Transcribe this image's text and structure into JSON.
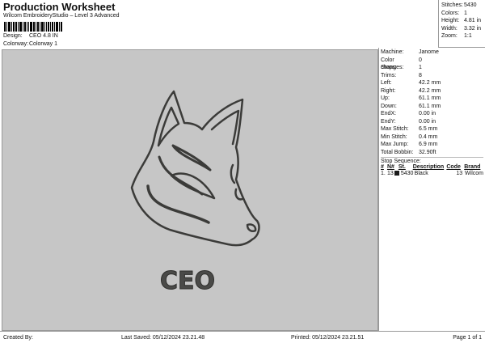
{
  "header": {
    "title": "Production Worksheet",
    "subtitle": "Wilcom EmbroideryStudio – Level 3 Advanced",
    "design_label": "Design:",
    "design_value": "CEO 4.8 IN",
    "colorway_label": "Colorway:",
    "colorway_value": "Colorway 1"
  },
  "summary": [
    {
      "k": "Stitches:",
      "v": "5430"
    },
    {
      "k": "Colors:",
      "v": "1"
    },
    {
      "k": "Height:",
      "v": "4.81 in"
    },
    {
      "k": "Width:",
      "v": "3.32 in"
    },
    {
      "k": "Zoom:",
      "v": "1:1"
    }
  ],
  "details": [
    {
      "k": "Machine:",
      "v": "Janome"
    },
    {
      "k": "Color changes:",
      "v": "0"
    },
    {
      "k": "Stops:",
      "v": "1"
    },
    {
      "k": "Trims:",
      "v": "8"
    },
    {
      "k": "Left:",
      "v": "42.2 mm"
    },
    {
      "k": "Right:",
      "v": "42.2 mm"
    },
    {
      "k": "Up:",
      "v": "61.1 mm"
    },
    {
      "k": "Down:",
      "v": "61.1 mm"
    },
    {
      "k": "EndX:",
      "v": "0.00 in"
    },
    {
      "k": "EndY:",
      "v": "0.00 in"
    },
    {
      "k": "Max Stitch:",
      "v": "6.5 mm"
    },
    {
      "k": "Min Stitch:",
      "v": "0.4 mm"
    },
    {
      "k": "Max Jump:",
      "v": "6.9 mm"
    },
    {
      "k": "Total Bobbin:",
      "v": "32.90ft"
    }
  ],
  "stop_sequence": {
    "title": "Stop Sequence:",
    "headers": [
      "#",
      "N#",
      "St.",
      "Description",
      "Code",
      "Brand"
    ],
    "rows": [
      {
        "num": "1.",
        "n": "13",
        "color": "#1a1a1a",
        "st": "5430",
        "desc": "Black",
        "code": "13",
        "brand": "Wilcom"
      }
    ]
  },
  "design": {
    "text": "CEO",
    "thread_color": "#3b3b39",
    "background": "#c6c6c6"
  },
  "footer": {
    "created": "Created By:",
    "saved": "Last Saved: 05/12/2024 23.21.48",
    "printed": "Printed: 05/12/2024 23.21.51",
    "page": "Page 1 of 1"
  }
}
